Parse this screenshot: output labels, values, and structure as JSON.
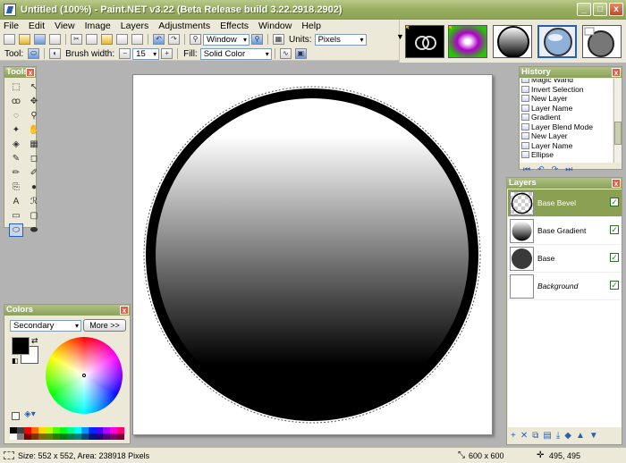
{
  "window": {
    "title": "Untitled (100%) - Paint.NET v3.22 (Beta Release build 3.22.2918.2902)",
    "controls": [
      "_",
      "□",
      "x"
    ]
  },
  "menu": [
    "File",
    "Edit",
    "View",
    "Image",
    "Layers",
    "Adjustments",
    "Effects",
    "Window",
    "Help"
  ],
  "toolbar": {
    "zoom_value": "Window",
    "units_label": "Units:",
    "units_value": "Pixels",
    "tool_label": "Tool:",
    "brush_label": "Brush width:",
    "brush_value": "15",
    "fill_label": "Fill:",
    "fill_value": "Solid Color"
  },
  "thumbnails": {
    "count": 5,
    "selected_index": 3
  },
  "tools_panel": {
    "title": "Tools",
    "close": "x",
    "icons": [
      "rectangle-select-icon",
      "move-selection-icon",
      "lasso-select-icon",
      "move-icon",
      "ellipse-select-icon",
      "zoom-icon",
      "magic-wand-icon",
      "pan-icon",
      "paint-bucket-icon",
      "gradient-icon",
      "paintbrush-icon",
      "eraser-icon",
      "pencil-icon",
      "color-picker-icon",
      "clone-stamp-icon",
      "recolor-icon",
      "text-icon",
      "line-curve-icon",
      "rectangle-icon",
      "rounded-rectangle-icon",
      "ellipse-icon",
      "freeform-shape-icon"
    ],
    "glyphs": [
      "⬚",
      "↖",
      "ꝏ",
      "✥",
      "◌",
      "⚲",
      "✦",
      "✋",
      "◈",
      "▦",
      "✎",
      "◻",
      "✏",
      "✐",
      "⎘",
      "●",
      "A",
      "ℛ",
      "▭",
      "▢",
      "⬭",
      "⬬"
    ],
    "selected": "ellipse-icon"
  },
  "colors_panel": {
    "title": "Colors",
    "close": "x",
    "mode": "Secondary",
    "more_button": "More >>",
    "primary": "#000000",
    "secondary": "#ffffff",
    "palette": [
      "#000000",
      "#404040",
      "#ff0000",
      "#ff6a00",
      "#ffd800",
      "#b6ff00",
      "#4cff00",
      "#00ff21",
      "#00ff90",
      "#00ffff",
      "#0094ff",
      "#0026ff",
      "#4800ff",
      "#b200ff",
      "#ff00dc",
      "#ff006e",
      "#ffffff",
      "#808080",
      "#7f0000",
      "#7f3300",
      "#7f6a00",
      "#5b7f00",
      "#267f00",
      "#007f0e",
      "#007f46",
      "#007f7f",
      "#004a7f",
      "#00137f",
      "#21007f",
      "#57007f",
      "#7f006e",
      "#7f0037"
    ]
  },
  "history_panel": {
    "title": "History",
    "close": "x",
    "items": [
      "Magic Wand",
      "Invert Selection",
      "New Layer",
      "Layer Name",
      "Gradient",
      "Layer Blend Mode",
      "New Layer",
      "Layer Name",
      "Ellipse"
    ],
    "nav": [
      "⏮",
      "↶",
      "↷",
      "⏭"
    ]
  },
  "layers_panel": {
    "title": "Layers",
    "close": "x",
    "layers": [
      {
        "name": "Base Bevel",
        "visible": true,
        "selected": true
      },
      {
        "name": "Base Gradient",
        "visible": true,
        "selected": false
      },
      {
        "name": "Base",
        "visible": true,
        "selected": false
      },
      {
        "name": "Background",
        "visible": true,
        "selected": false
      }
    ],
    "footer": [
      "+",
      "✕",
      "⧉",
      "▤",
      "⤓",
      "◆",
      "▲",
      "▼"
    ]
  },
  "canvas": {
    "colors": {
      "ring": "#000000",
      "gradient_top": "#ffffff",
      "gradient_bottom": "#000000",
      "background": "#ffffff"
    }
  },
  "status": {
    "selection": "Size: 552 x 552, Area: 238918 Pixels",
    "image_size": "600 x 600",
    "cursor": "495, 495"
  }
}
